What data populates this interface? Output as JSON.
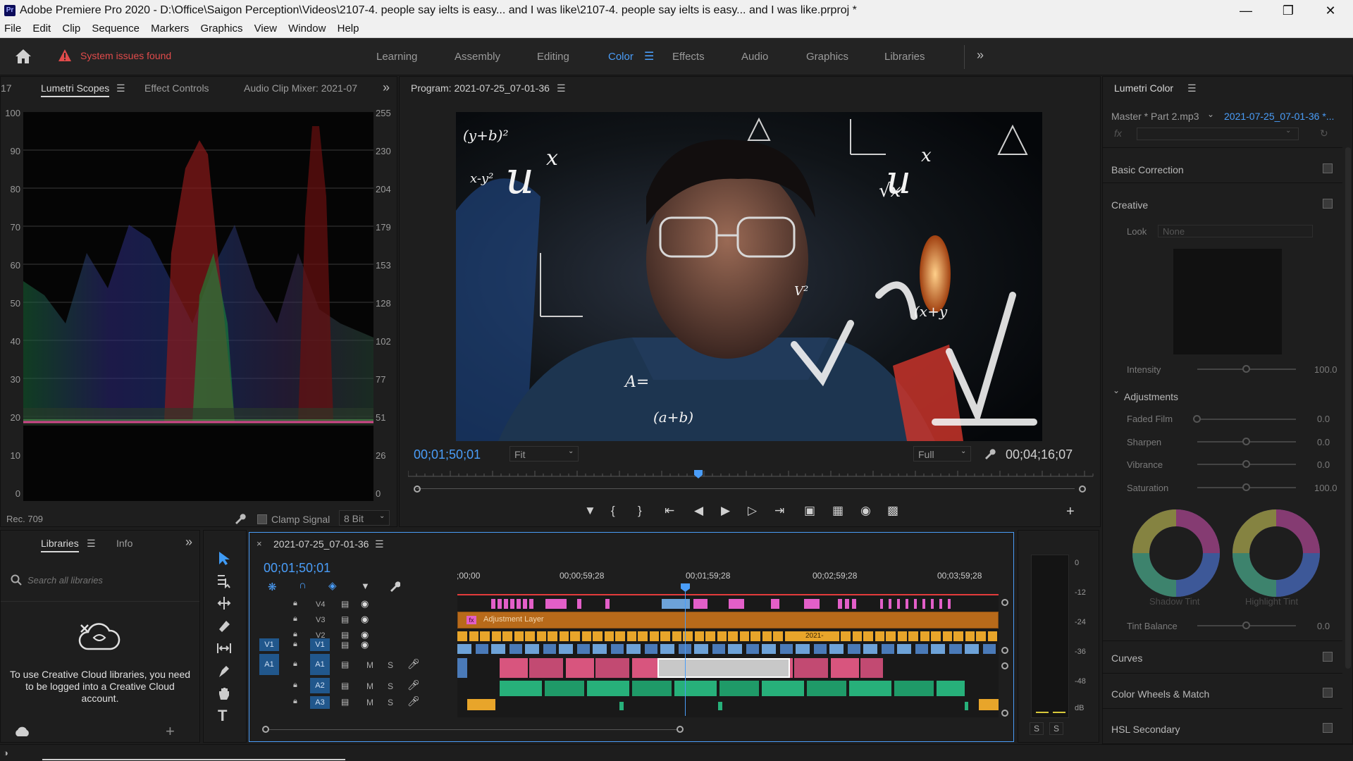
{
  "app": {
    "title": "Adobe Premiere Pro 2020 - D:\\Office\\Saigon Perception\\Videos\\2107-4. people say ielts is easy... and I was like\\2107-4. people say ielts is easy... and I was like.prproj *",
    "logo": "Pr",
    "menu": [
      "File",
      "Edit",
      "Clip",
      "Sequence",
      "Markers",
      "Graphics",
      "View",
      "Window",
      "Help"
    ]
  },
  "workspace": {
    "alert": "System issues found",
    "tabs": [
      "Learning",
      "Assembly",
      "Editing",
      "Color",
      "Effects",
      "Audio",
      "Graphics",
      "Libraries"
    ],
    "active": "Color"
  },
  "scopes": {
    "left_num": "17",
    "tabs": [
      "Lumetri Scopes",
      "Effect Controls",
      "Audio Clip Mixer: 2021-07"
    ],
    "left_scale": [
      "100",
      "90",
      "80",
      "70",
      "60",
      "50",
      "40",
      "30",
      "20",
      "10",
      "0"
    ],
    "right_scale": [
      "255",
      "230",
      "204",
      "179",
      "153",
      "128",
      "102",
      "77",
      "51",
      "26",
      "0"
    ],
    "colorspace": "Rec. 709",
    "clamp_label": "Clamp Signal",
    "bit_depth": "8 Bit"
  },
  "program": {
    "title": "Program: 2021-07-25_07-01-36",
    "timecode": "00;01;50;01",
    "fit": "Fit",
    "quality": "Full",
    "duration": "00;04;16;07"
  },
  "lumetri": {
    "title": "Lumetri Color",
    "master": "Master * Part 2.mp3",
    "sequence": "2021-07-25_07-01-36 *...",
    "fx": "fx",
    "sections": {
      "basic": "Basic Correction",
      "creative": "Creative",
      "look_label": "Look",
      "look_value": "None",
      "intensity": "Intensity",
      "intensity_val": "100.0",
      "adjustments": "Adjustments",
      "faded": "Faded Film",
      "faded_val": "0.0",
      "sharpen": "Sharpen",
      "sharpen_val": "0.0",
      "vibrance": "Vibrance",
      "vibrance_val": "0.0",
      "saturation": "Saturation",
      "saturation_val": "100.0",
      "shadow_tint": "Shadow Tint",
      "highlight_tint": "Highlight Tint",
      "tint_balance": "Tint Balance",
      "tint_val": "0.0",
      "curves": "Curves",
      "wheels": "Color Wheels & Match",
      "hsl": "HSL Secondary"
    }
  },
  "libraries": {
    "tabs": [
      "Libraries",
      "Info"
    ],
    "search_placeholder": "Search all libraries",
    "message": "To use Creative Cloud libraries, you need to be logged into a Creative Cloud account."
  },
  "timeline": {
    "name": "2021-07-25_07-01-36",
    "timecode": "00;01;50;01",
    "ruler": [
      ";00;00",
      "00;00;59;28",
      "00;01;59;28",
      "00;02;59;28",
      "00;03;59;28"
    ],
    "adjustment_label": "Adjustment Layer",
    "clip_label": "2021-",
    "tracks": {
      "v4": "V4",
      "v3": "V3",
      "v2": "V2",
      "v1": "V1",
      "a1": "A1",
      "a2": "A2",
      "a3": "A3",
      "src_v1": "V1",
      "src_a1": "A1",
      "m": "M",
      "s": "S"
    }
  },
  "meter": {
    "scale": [
      "0",
      "-12",
      "-24",
      "-36",
      "-48",
      "dB"
    ],
    "solo": [
      "S",
      "S"
    ]
  },
  "colors": {
    "accent": "#4a9df8",
    "audio_pink": "#d8557e",
    "audio_green": "#27b07a",
    "video_orange": "#e8a52a",
    "video_blue": "#6da2d8",
    "video_pink": "#e35fc8"
  }
}
